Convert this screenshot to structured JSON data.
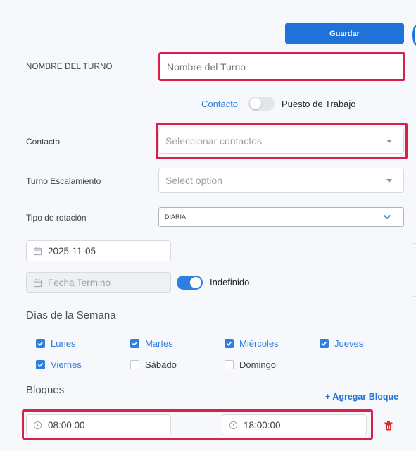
{
  "toolbar": {
    "save_label": "Guardar"
  },
  "form": {
    "shift_name": {
      "label": "NOMBRE DEL TURNO",
      "placeholder": "Nombre del Turno"
    },
    "assign_toggle": {
      "left_label": "Contacto",
      "right_label": "Puesto de Trabajo",
      "on": false
    },
    "contact": {
      "label": "Contacto",
      "placeholder": "Seleccionar contactos"
    },
    "escalation": {
      "label": "Turno Escalamiento",
      "placeholder": "Select option"
    },
    "rotation": {
      "label": "Tipo de rotación",
      "value": "DIARIA"
    },
    "start_date": {
      "value": "2025-11-05"
    },
    "end_date": {
      "placeholder": "Fecha Termino"
    },
    "indefinite": {
      "label": "Indefinido",
      "on": true
    }
  },
  "weekdays": {
    "title": "Días de la Semana",
    "days": [
      {
        "label": "Lunes",
        "checked": true
      },
      {
        "label": "Martes",
        "checked": true
      },
      {
        "label": "Miércoles",
        "checked": true
      },
      {
        "label": "Jueves",
        "checked": true
      },
      {
        "label": "Viernes",
        "checked": true
      },
      {
        "label": "Sábado",
        "checked": false
      },
      {
        "label": "Domingo",
        "checked": false
      }
    ]
  },
  "blocks": {
    "title": "Bloques",
    "add_label": "+ Agregar Bloque",
    "items": [
      {
        "start": "08:00:00",
        "end": "18:00:00"
      }
    ]
  },
  "colors": {
    "accent": "#1f73d8",
    "highlight": "#dc1e4a",
    "delete": "#d92b2b"
  },
  "icons": [
    "calendar-icon",
    "clock-icon",
    "chevron-down-icon",
    "trash-icon",
    "check-icon"
  ]
}
